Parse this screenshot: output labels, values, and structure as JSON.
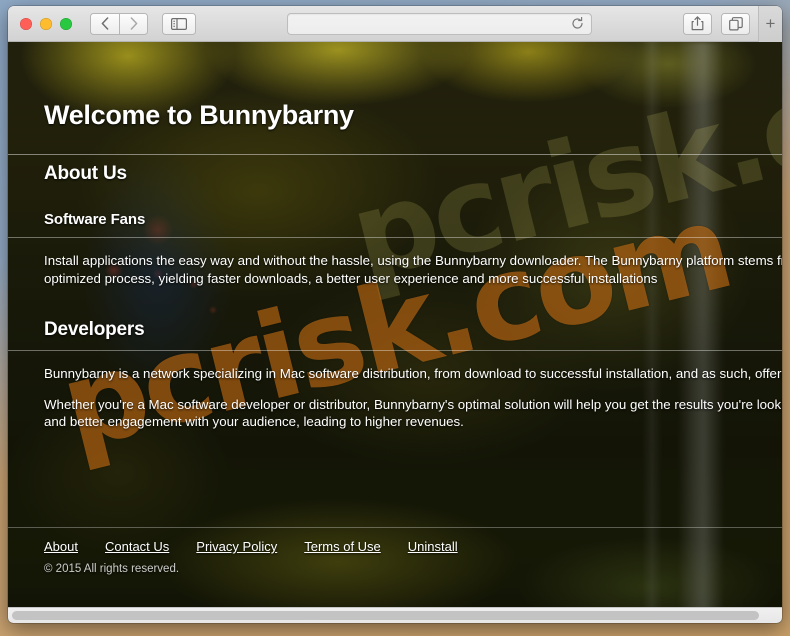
{
  "browser": {
    "name": "Safari",
    "traffic_lights": [
      {
        "name": "close",
        "color": "#ff5f57"
      },
      {
        "name": "minimize",
        "color": "#febc2e"
      },
      {
        "name": "zoom",
        "color": "#28c840"
      }
    ],
    "back_label": "‹",
    "forward_label": "›",
    "sidebar_label": "Show Sidebar",
    "address": {
      "value": "",
      "placeholder": ""
    },
    "reload_label": "Reload",
    "share_label": "Share",
    "tabs_label": "Show All Tabs",
    "new_tab_label": "+"
  },
  "page": {
    "hero_title": "Welcome to Bunnybarny",
    "sections": [
      {
        "heading": "About Us",
        "subheading": "Software Fans",
        "paragraphs": [
          "Install applications the easy way and without the hassle, using the Bunnybarny downloader. The Bunnybarny platform stems from years of experience with installing applications, resulting in a highly optimized process, yielding faster downloads, a better user experience and more successful installations"
        ]
      },
      {
        "heading": "Developers",
        "paragraphs": [
          "Bunnybarny is a network specializing in Mac software distribution, from download to successful installation, and as such, offering a better way for you to reach the Mac software community.",
          "Whether you're a Mac software developer or distributor, Bunnybarny's optimal solution will help you get the results you're looking for, providing you with detailed insights into the installation process and better engagement with your audience, leading to higher revenues."
        ]
      }
    ],
    "footer": {
      "links": [
        {
          "label": "About"
        },
        {
          "label": "Contact Us"
        },
        {
          "label": "Privacy Policy"
        },
        {
          "label": "Terms of Use"
        },
        {
          "label": "Uninstall"
        }
      ],
      "copyright": "© 2015 All rights reserved."
    },
    "watermark": "pcrisk.com"
  },
  "colors": {
    "text": "#ffffff",
    "watermark": "#de7a16",
    "toolbar": "#e6e6e6",
    "page_background": "#1d1c0e"
  }
}
